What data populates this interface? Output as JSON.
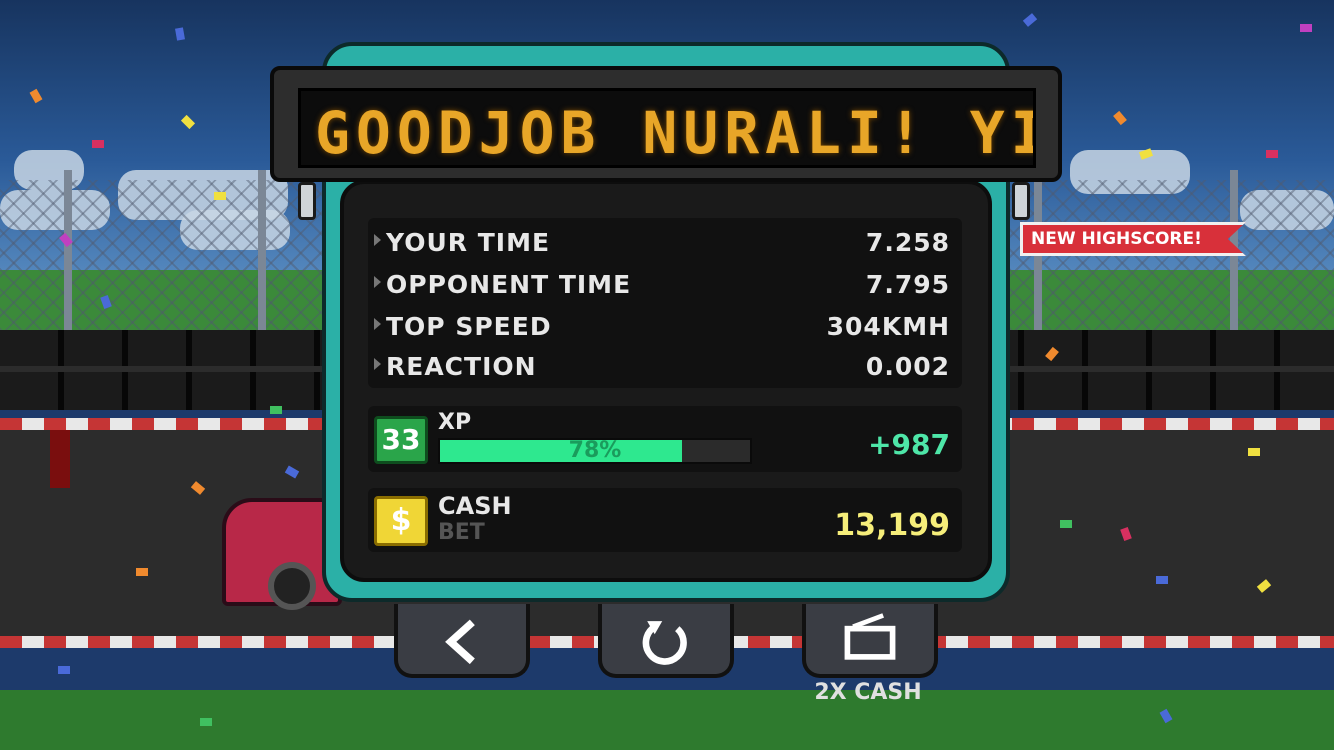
{
  "ticker": {
    "message": "GOODJOB NURALI!  YI"
  },
  "stats": [
    {
      "label": "YOUR TIME",
      "value": "7.258"
    },
    {
      "label": "OPPONENT TIME",
      "value": "7.795"
    },
    {
      "label": "TOP SPEED",
      "value": "304KMH"
    },
    {
      "label": "REACTION",
      "value": "0.002"
    }
  ],
  "highscore_badge": "NEW HIGHSCORE!",
  "xp": {
    "level": "33",
    "label": "XP",
    "progress_percent": 78,
    "progress_text": "78%",
    "gain": "+987"
  },
  "cash": {
    "icon_symbol": "$",
    "label": "CASH",
    "sub_label": "BET",
    "amount": "13,199"
  },
  "buttons": {
    "back_icon": "chevron-left-icon",
    "restart_icon": "restart-icon",
    "ad_icon": "tv-icon",
    "ad_caption": "2X CASH"
  },
  "colors": {
    "board_frame": "#2bb0a7",
    "ticker_text": "#e8a628",
    "xp_fill": "#2ee88f",
    "xp_gain": "#4ee6a8",
    "cash_amount": "#f6ee7a",
    "level_badge": "#2aa54a",
    "cash_badge": "#f0d636",
    "highscore_badge": "#d8303a"
  }
}
